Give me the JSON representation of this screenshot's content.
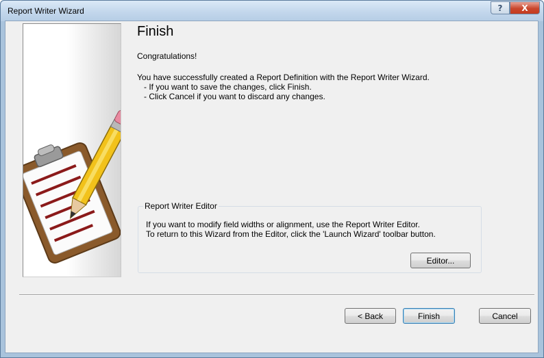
{
  "window": {
    "title": "Report Writer Wizard",
    "help_glyph": "?",
    "close_glyph": "X"
  },
  "page": {
    "heading": "Finish",
    "congrats": "Congratulations!",
    "lines": [
      "You have successfully created a Report Definition with the Report Writer Wizard.",
      "- If you want to save the changes, click Finish.",
      "- Click Cancel if you want to discard any changes."
    ]
  },
  "group": {
    "title": "Report Writer Editor",
    "lines": [
      "If you want to modify field widths or alignment, use the Report Writer Editor.",
      "To return to this Wizard from the Editor, click the 'Launch Wizard' toolbar button."
    ],
    "editor_label": "Editor..."
  },
  "buttons": {
    "back": "< Back",
    "finish": "Finish",
    "cancel": "Cancel"
  },
  "icons": {
    "side_image": "clipboard-pencil-icon"
  }
}
